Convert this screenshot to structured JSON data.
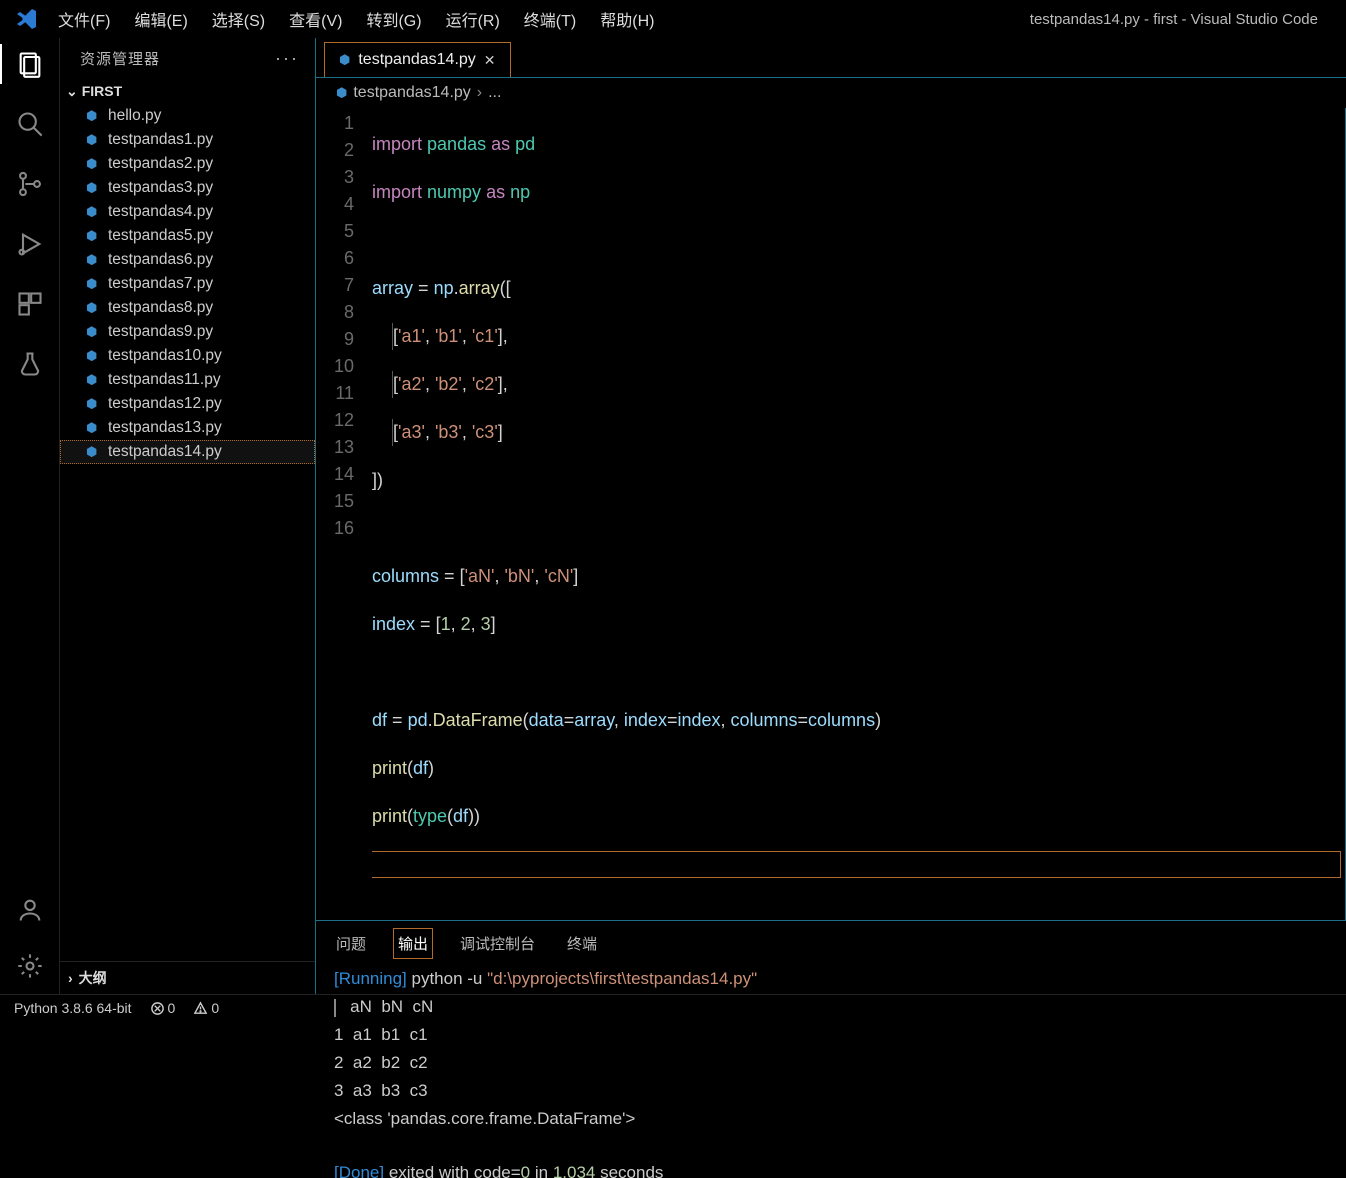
{
  "window_title": "testpandas14.py - first - Visual Studio Code",
  "menu": [
    "文件(F)",
    "编辑(E)",
    "选择(S)",
    "查看(V)",
    "转到(G)",
    "运行(R)",
    "终端(T)",
    "帮助(H)"
  ],
  "sidebar": {
    "title": "资源管理器",
    "folder": "FIRST",
    "files": [
      "hello.py",
      "testpandas1.py",
      "testpandas2.py",
      "testpandas3.py",
      "testpandas4.py",
      "testpandas5.py",
      "testpandas6.py",
      "testpandas7.py",
      "testpandas8.py",
      "testpandas9.py",
      "testpandas10.py",
      "testpandas11.py",
      "testpandas12.py",
      "testpandas13.py",
      "testpandas14.py"
    ],
    "selected": "testpandas14.py",
    "outline": "大纲"
  },
  "tab": {
    "label": "testpandas14.py"
  },
  "breadcrumb": {
    "file": "testpandas14.py",
    "rest": "..."
  },
  "panel": {
    "tabs": [
      "问题",
      "输出",
      "调试控制台",
      "终端"
    ],
    "active": "输出",
    "running": "[Running]",
    "cmd": " python -u ",
    "path": "\"d:\\pyprojects\\first\\testpandas14.py\"",
    "df_header": "   aN  bN  cN",
    "df_rows": [
      "1  a1  b1  c1",
      "2  a2  b2  c2",
      "3  a3  b3  c3"
    ],
    "class_line": "<class 'pandas.core.frame.DataFrame'>",
    "done": "[Done]",
    "done_rest1": " exited with code=",
    "done_code": "0",
    "done_rest2": " in ",
    "done_time": "1.034",
    "done_rest3": " seconds"
  },
  "status": {
    "python": "Python 3.8.6 64-bit",
    "errors": "0",
    "warnings": "0"
  },
  "code": {
    "lines": [
      "1",
      "2",
      "3",
      "4",
      "5",
      "6",
      "7",
      "8",
      "9",
      "10",
      "11",
      "12",
      "13",
      "14",
      "15",
      "16"
    ]
  }
}
